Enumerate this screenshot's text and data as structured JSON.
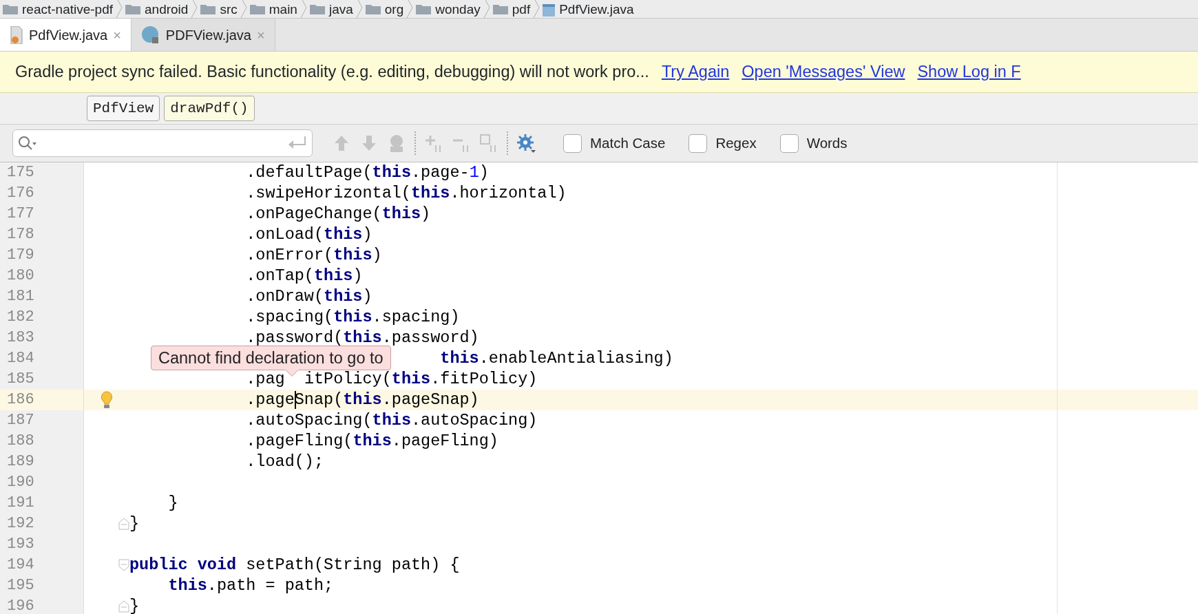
{
  "breadcrumb": [
    {
      "label": "react-native-pdf",
      "kind": "folder"
    },
    {
      "label": "android",
      "kind": "folder"
    },
    {
      "label": "src",
      "kind": "folder"
    },
    {
      "label": "main",
      "kind": "folder"
    },
    {
      "label": "java",
      "kind": "folder"
    },
    {
      "label": "org",
      "kind": "folder"
    },
    {
      "label": "wonday",
      "kind": "folder"
    },
    {
      "label": "pdf",
      "kind": "folder"
    },
    {
      "label": "PdfView.java",
      "kind": "java"
    }
  ],
  "tabs": [
    {
      "label": "PdfView.java",
      "kind": "java",
      "selected": true,
      "close": "×"
    },
    {
      "label": "PDFView.java",
      "kind": "class",
      "selected": false,
      "close": "×"
    }
  ],
  "banner": {
    "message": "Gradle project sync failed. Basic functionality (e.g. editing, debugging) will not work pro...",
    "links": [
      "Try Again",
      "Open 'Messages' View",
      "Show Log in F"
    ]
  },
  "structure": [
    {
      "label": "PdfView",
      "selected": false
    },
    {
      "label": "drawPdf()",
      "selected": true
    }
  ],
  "find_bar": {
    "options": [
      {
        "label": "Match Case",
        "checked": false
      },
      {
        "label": "Regex",
        "checked": false
      },
      {
        "label": "Words",
        "checked": false
      }
    ]
  },
  "lines": [
    {
      "number": "175",
      "current": false,
      "bulb": false,
      "tokens": [
        {
          "kind": "plain",
          "text": "            .defaultPage("
        },
        {
          "kind": "keyword",
          "text": "this"
        },
        {
          "kind": "plain",
          "text": ".page-"
        },
        {
          "kind": "number",
          "text": "1"
        },
        {
          "kind": "plain",
          "text": ")"
        }
      ]
    },
    {
      "number": "176",
      "current": false,
      "bulb": false,
      "tokens": [
        {
          "kind": "plain",
          "text": "            .swipeHorizontal("
        },
        {
          "kind": "keyword",
          "text": "this"
        },
        {
          "kind": "plain",
          "text": ".horizontal)"
        }
      ]
    },
    {
      "number": "177",
      "current": false,
      "bulb": false,
      "tokens": [
        {
          "kind": "plain",
          "text": "            .onPageChange("
        },
        {
          "kind": "keyword",
          "text": "this"
        },
        {
          "kind": "plain",
          "text": ")"
        }
      ]
    },
    {
      "number": "178",
      "current": false,
      "bulb": false,
      "tokens": [
        {
          "kind": "plain",
          "text": "            .onLoad("
        },
        {
          "kind": "keyword",
          "text": "this"
        },
        {
          "kind": "plain",
          "text": ")"
        }
      ]
    },
    {
      "number": "179",
      "current": false,
      "bulb": false,
      "tokens": [
        {
          "kind": "plain",
          "text": "            .onError("
        },
        {
          "kind": "keyword",
          "text": "this"
        },
        {
          "kind": "plain",
          "text": ")"
        }
      ]
    },
    {
      "number": "180",
      "current": false,
      "bulb": false,
      "tokens": [
        {
          "kind": "plain",
          "text": "            .onTap("
        },
        {
          "kind": "keyword",
          "text": "this"
        },
        {
          "kind": "plain",
          "text": ")"
        }
      ]
    },
    {
      "number": "181",
      "current": false,
      "bulb": false,
      "tokens": [
        {
          "kind": "plain",
          "text": "            .onDraw("
        },
        {
          "kind": "keyword",
          "text": "this"
        },
        {
          "kind": "plain",
          "text": ")"
        }
      ]
    },
    {
      "number": "182",
      "current": false,
      "bulb": false,
      "tokens": [
        {
          "kind": "plain",
          "text": "            .spacing("
        },
        {
          "kind": "keyword",
          "text": "this"
        },
        {
          "kind": "plain",
          "text": ".spacing)"
        }
      ]
    },
    {
      "number": "183",
      "current": false,
      "bulb": false,
      "tokens": [
        {
          "kind": "plain",
          "text": "            .password("
        },
        {
          "kind": "keyword",
          "text": "this"
        },
        {
          "kind": "plain",
          "text": ".password)"
        }
      ]
    },
    {
      "number": "184",
      "current": false,
      "bulb": false,
      "tokens": [
        {
          "kind": "keyword",
          "text": "                                this"
        },
        {
          "kind": "plain",
          "text": ".enableAntialiasing)"
        }
      ]
    },
    {
      "number": "185",
      "current": false,
      "bulb": false,
      "tokens": [
        {
          "kind": "plain",
          "text": "            .pag"
        },
        {
          "kind": "plain",
          "text": "  itPolicy("
        },
        {
          "kind": "keyword",
          "text": "this"
        },
        {
          "kind": "plain",
          "text": ".fitPolicy)"
        }
      ]
    },
    {
      "number": "186",
      "current": true,
      "bulb": true,
      "tokens": [
        {
          "kind": "plain",
          "text": "            .page"
        },
        {
          "kind": "caret"
        },
        {
          "kind": "plain",
          "text": "Snap("
        },
        {
          "kind": "keyword",
          "text": "this"
        },
        {
          "kind": "plain",
          "text": ".pageSnap)"
        }
      ]
    },
    {
      "number": "187",
      "current": false,
      "bulb": false,
      "tokens": [
        {
          "kind": "plain",
          "text": "            .autoSpacing("
        },
        {
          "kind": "keyword",
          "text": "this"
        },
        {
          "kind": "plain",
          "text": ".autoSpacing)"
        }
      ]
    },
    {
      "number": "188",
      "current": false,
      "bulb": false,
      "tokens": [
        {
          "kind": "plain",
          "text": "            .pageFling("
        },
        {
          "kind": "keyword",
          "text": "this"
        },
        {
          "kind": "plain",
          "text": ".pageFling)"
        }
      ]
    },
    {
      "number": "189",
      "current": false,
      "bulb": false,
      "tokens": [
        {
          "kind": "plain",
          "text": "            .load();"
        }
      ]
    },
    {
      "number": "190",
      "current": false,
      "bulb": false
    },
    {
      "number": "191",
      "current": false,
      "bulb": false,
      "tokens": [
        {
          "kind": "plain",
          "text": "    }"
        }
      ]
    },
    {
      "number": "192",
      "current": false,
      "bulb": false,
      "fold": {
        "kind": "end"
      },
      "tokens": [
        {
          "kind": "plain",
          "text": "}"
        }
      ]
    },
    {
      "number": "193",
      "current": false,
      "bulb": false
    },
    {
      "number": "194",
      "current": false,
      "bulb": false,
      "fold": {
        "kind": "start"
      },
      "tokens": [
        {
          "kind": "keyword",
          "text": "public "
        },
        {
          "kind": "keyword",
          "text": "void"
        },
        {
          "kind": "plain",
          "text": " setPath(String path) {"
        }
      ]
    },
    {
      "number": "195",
      "current": false,
      "bulb": false,
      "tokens": [
        {
          "kind": "keyword",
          "text": "    this"
        },
        {
          "kind": "plain",
          "text": ".path = path;"
        }
      ]
    },
    {
      "number": "196",
      "current": false,
      "bulb": false,
      "fold": {
        "kind": "end"
      },
      "tokens": [
        {
          "kind": "plain",
          "text": "}"
        }
      ]
    }
  ],
  "tooltip": {
    "text": "Cannot find declaration to go to"
  }
}
